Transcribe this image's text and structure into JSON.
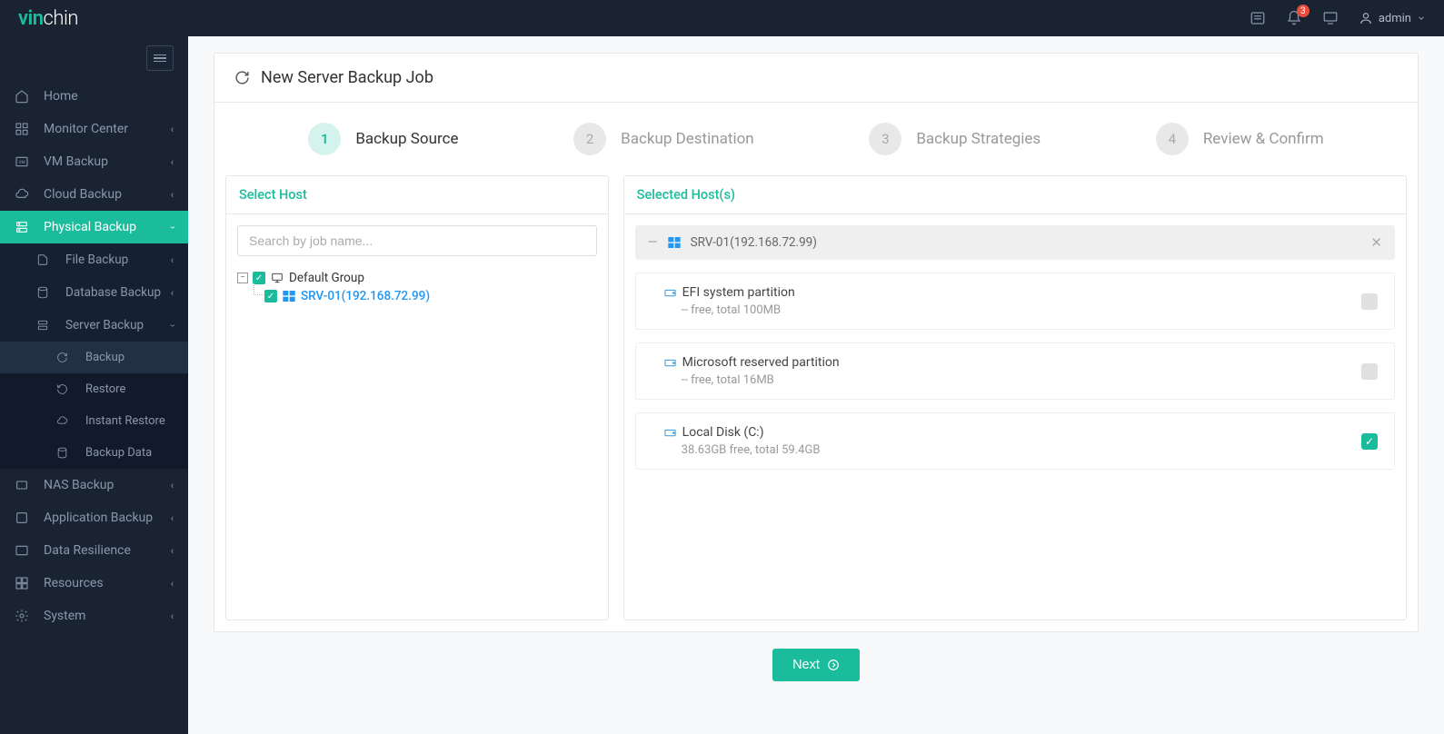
{
  "brand": {
    "accent": "vin",
    "rest": "chin"
  },
  "header": {
    "notification_count": "3",
    "user": "admin"
  },
  "sidebar": {
    "items": [
      {
        "label": "Home"
      },
      {
        "label": "Monitor Center"
      },
      {
        "label": "VM Backup"
      },
      {
        "label": "Cloud Backup"
      },
      {
        "label": "Physical Backup"
      },
      {
        "label": "NAS Backup"
      },
      {
        "label": "Application Backup"
      },
      {
        "label": "Data Resilience"
      },
      {
        "label": "Resources"
      },
      {
        "label": "System"
      }
    ],
    "physical_sub": [
      {
        "label": "File Backup"
      },
      {
        "label": "Database Backup"
      },
      {
        "label": "Server Backup"
      }
    ],
    "server_backup_sub": [
      {
        "label": "Backup"
      },
      {
        "label": "Restore"
      },
      {
        "label": "Instant Restore"
      },
      {
        "label": "Backup Data"
      }
    ]
  },
  "page": {
    "title": "New Server Backup Job"
  },
  "wizard": [
    {
      "num": "1",
      "label": "Backup Source"
    },
    {
      "num": "2",
      "label": "Backup Destination"
    },
    {
      "num": "3",
      "label": "Backup Strategies"
    },
    {
      "num": "4",
      "label": "Review & Confirm"
    }
  ],
  "left_panel": {
    "title": "Select Host",
    "search_placeholder": "Search by job name...",
    "tree_group": "Default Group",
    "tree_host": "SRV-01(192.168.72.99)"
  },
  "right_panel": {
    "title": "Selected Host(s)",
    "host": "SRV-01(192.168.72.99)",
    "disks": [
      {
        "name": "EFI system partition",
        "sub": "-- free, total 100MB",
        "checked": false
      },
      {
        "name": "Microsoft reserved partition",
        "sub": "-- free, total 16MB",
        "checked": false
      },
      {
        "name": "Local Disk (C:)",
        "sub": "38.63GB free, total 59.4GB",
        "checked": true
      }
    ]
  },
  "buttons": {
    "next": "Next"
  }
}
